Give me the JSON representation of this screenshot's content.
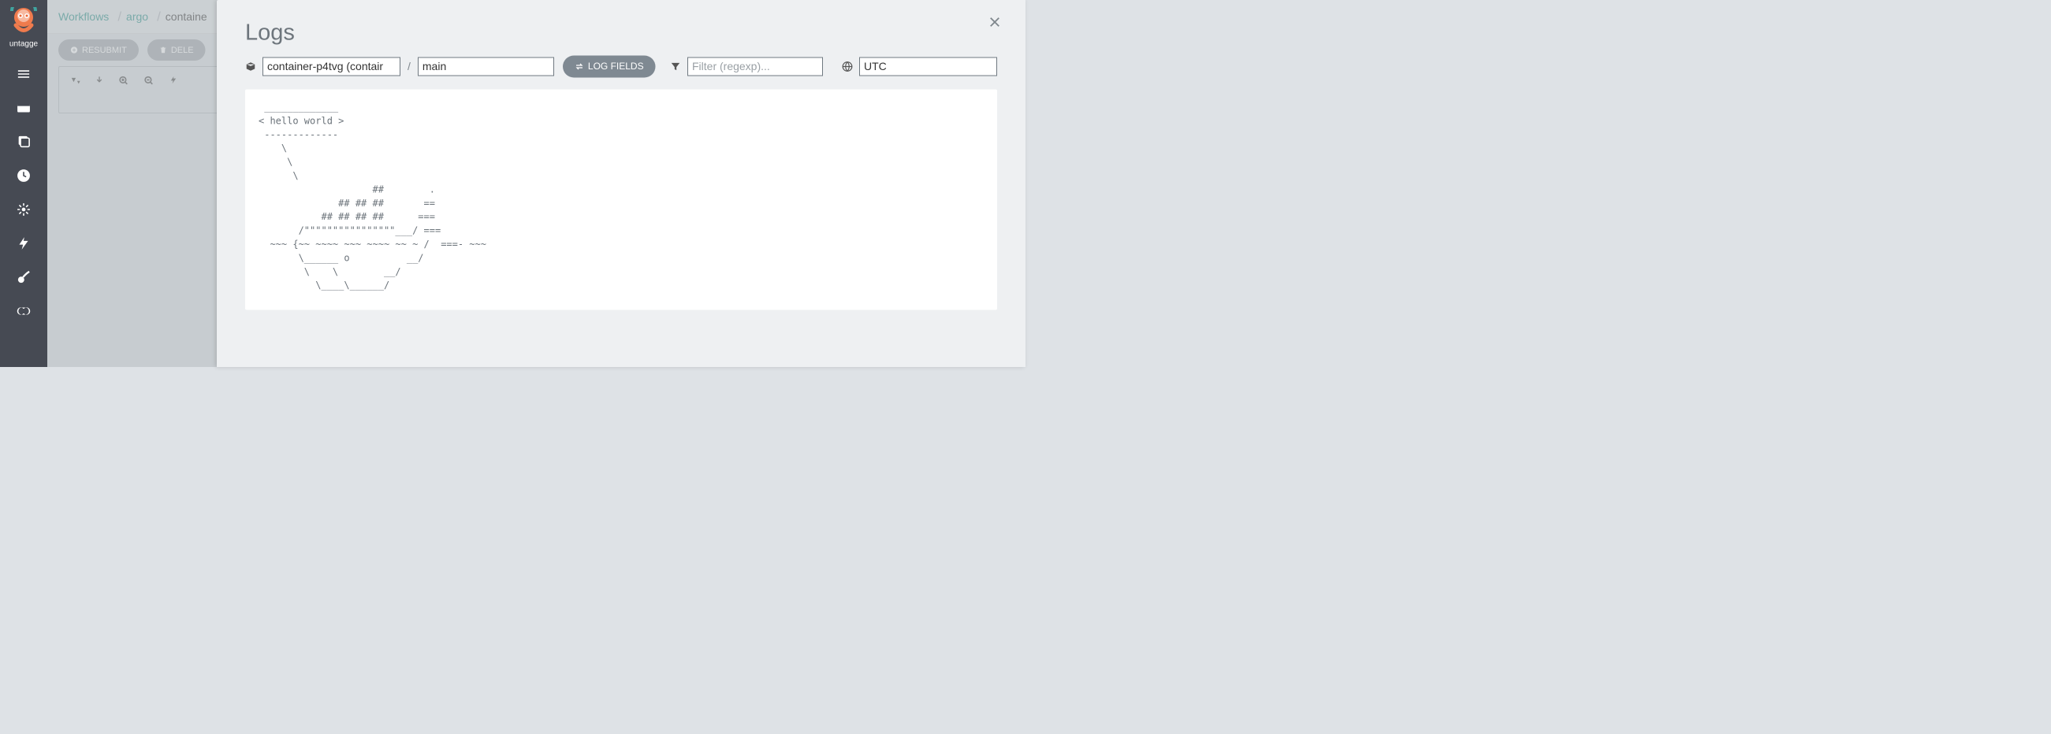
{
  "brand": {
    "label": "untagge"
  },
  "breadcrumb": {
    "items": [
      "Workflows",
      "argo",
      "containe"
    ]
  },
  "actions": {
    "resubmit": "RESUBMIT",
    "delete": "DELE"
  },
  "modal": {
    "title": "Logs",
    "workflow_value": "container-p4tvg (contair",
    "container_value": "main",
    "log_fields_label": "LOG FIELDS",
    "filter_placeholder": "Filter (regexp)...",
    "timezone_value": "UTC"
  },
  "log_output": " _____________\n< hello world >\n -------------\n    \\\n     \\\n      \\\n                    ##        .\n              ## ## ##       ==\n           ## ## ## ##      ===\n       /\"\"\"\"\"\"\"\"\"\"\"\"\"\"\"\"___/ ===\n  ~~~ {~~ ~~~~ ~~~ ~~~~ ~~ ~ /  ===- ~~~\n       \\______ o          __/\n        \\    \\        __/\n          \\____\\______/"
}
